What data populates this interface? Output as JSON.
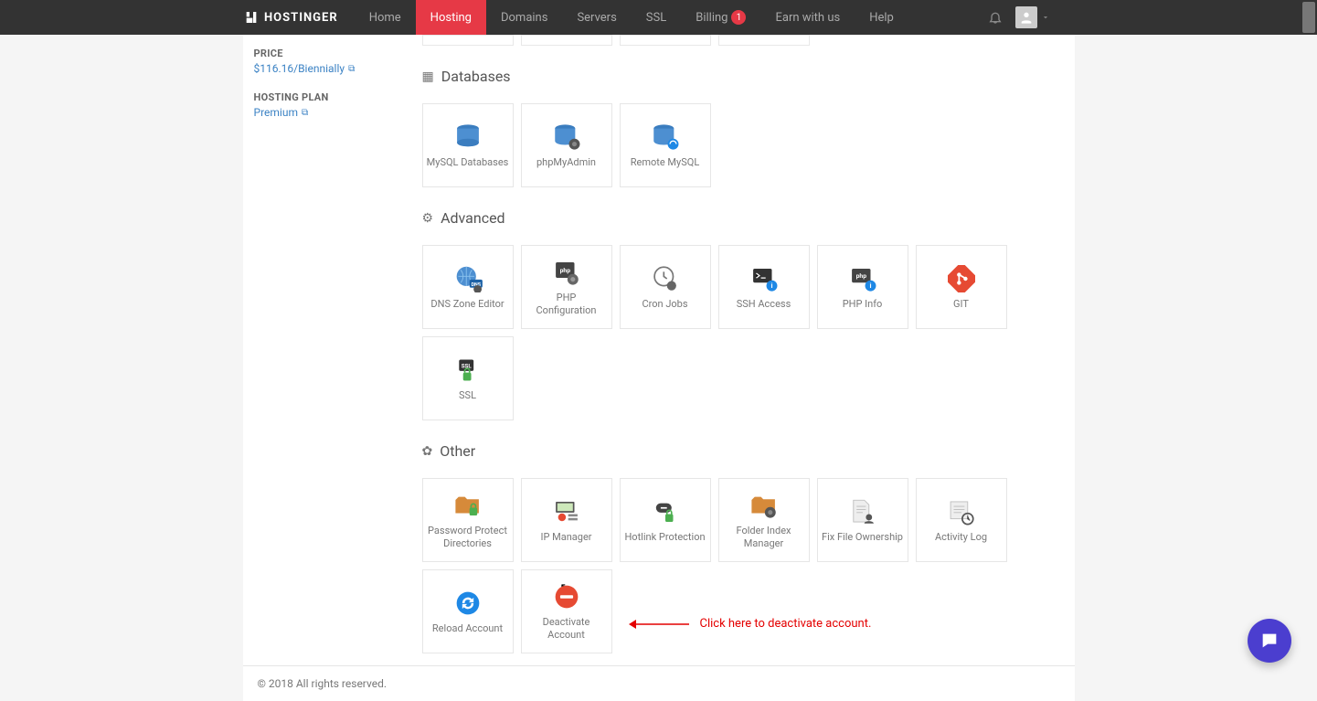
{
  "brand": "HOSTINGER",
  "nav": {
    "home": "Home",
    "hosting": "Hosting",
    "domains": "Domains",
    "servers": "Servers",
    "ssl": "SSL",
    "billing": "Billing",
    "billing_badge": "1",
    "earn": "Earn with us",
    "help": "Help"
  },
  "sidebar": {
    "price_label": "PRICE",
    "price_value": "$116.16/Biennially",
    "plan_label": "HOSTING PLAN",
    "plan_value": "Premium"
  },
  "sections": {
    "databases": {
      "title": "Databases",
      "items": {
        "mysql": "MySQL Databases",
        "phpmyadmin": "phpMyAdmin",
        "remote": "Remote MySQL"
      }
    },
    "advanced": {
      "title": "Advanced",
      "items": {
        "dns": "DNS Zone Editor",
        "phpconf": "PHP Configuration",
        "cron": "Cron Jobs",
        "ssh": "SSH Access",
        "phpinfo": "PHP Info",
        "git": "GIT",
        "ssl": "SSL"
      }
    },
    "other": {
      "title": "Other",
      "items": {
        "pwd": "Password Protect Directories",
        "ipm": "IP Manager",
        "hotlink": "Hotlink Protection",
        "folder": "Folder Index Manager",
        "fix": "Fix File Ownership",
        "activity": "Activity Log",
        "reload": "Reload Account",
        "deactivate": "Deactivate Account"
      }
    }
  },
  "annotation": "Click here to deactivate account.",
  "footer": "© 2018 All rights reserved."
}
